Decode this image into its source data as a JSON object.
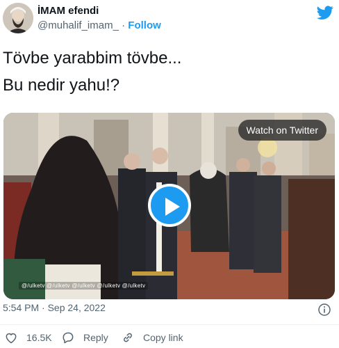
{
  "author": {
    "name": "İMAM efendi",
    "handle": "@muhalif_imam_",
    "separator": "·",
    "follow_label": "Follow"
  },
  "tweet": {
    "text": "Tövbe yarabbim tövbe...\nBu nedir yahu!?"
  },
  "media": {
    "watch_label": "Watch on Twitter",
    "watermark": "@/ulketv @/ulketv @/ulketv @/ulketv @/ulketv"
  },
  "meta": {
    "timestamp": "5:54 PM · Sep 24, 2022"
  },
  "actions": {
    "likes": "16.5K",
    "reply_label": "Reply",
    "copy_label": "Copy link"
  },
  "colors": {
    "accent": "#1d9bf0",
    "text": "#0f1419",
    "secondary": "#536471"
  },
  "icons": [
    "twitter-bird-icon",
    "play-icon",
    "info-icon",
    "heart-icon",
    "reply-icon",
    "link-icon"
  ]
}
